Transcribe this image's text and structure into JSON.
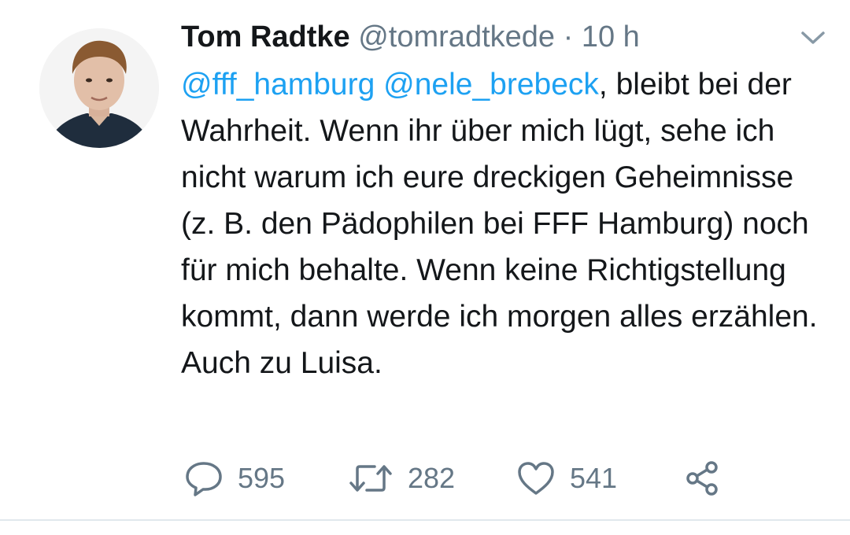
{
  "tweet": {
    "author_name": "Tom Radtke",
    "author_handle": "@tomradtkede",
    "separator": "·",
    "timestamp": "10 h",
    "text": {
      "mention_1": "@fff_hamburg",
      "mention_2": "@nele_brebeck",
      "body": ", bleibt bei der Wahrheit. Wenn ihr über mich lügt, sehe ich nicht warum ich eure dreckigen Geheimnisse (z. B. den Pädophilen bei FFF Hamburg) noch für mich behalte. Wenn keine Richtigstellung kommt, dann werde ich morgen alles erzählen. Auch zu Luisa."
    },
    "actions": {
      "reply_count": "595",
      "retweet_count": "282",
      "like_count": "541"
    },
    "icons": {
      "more": "chevron-down-icon",
      "reply": "speech-bubble-icon",
      "retweet": "retweet-arrows-icon",
      "like": "heart-outline-icon",
      "share": "share-nodes-icon"
    }
  },
  "colors": {
    "text": "#14171a",
    "secondary": "#657786",
    "link": "#1da1f2",
    "divider": "#e1e8ed"
  }
}
